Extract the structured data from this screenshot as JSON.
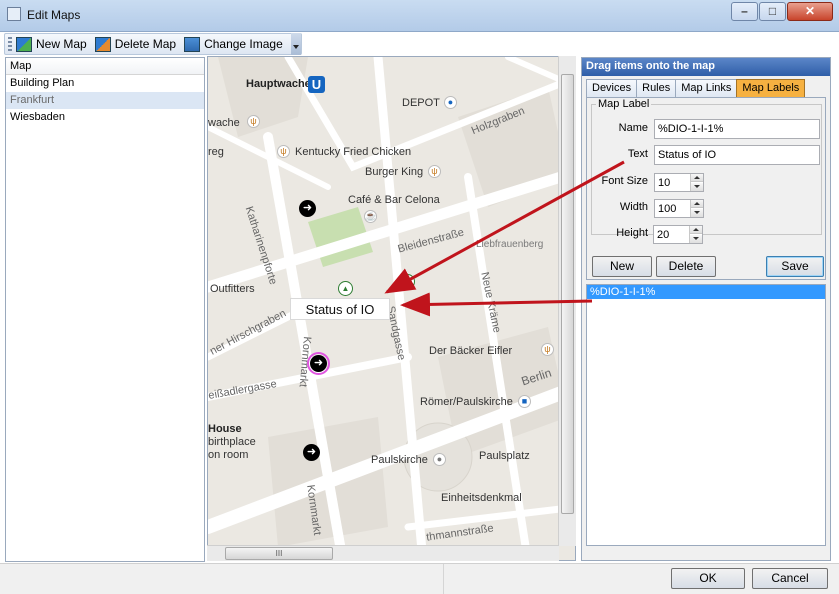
{
  "window": {
    "title": "Edit Maps",
    "min_glyph": "–",
    "max_glyph": "□",
    "close_glyph": "✕"
  },
  "toolbar": {
    "new_map": "New Map",
    "delete_map": "Delete Map",
    "change_image": "Change Image"
  },
  "map_list": {
    "header": "Map",
    "items": [
      "Building Plan",
      "Frankfurt",
      "Wiesbaden"
    ],
    "selected": "Frankfurt"
  },
  "map": {
    "labels": {
      "hauptwache": "Hauptwache",
      "depot": "DEPOT",
      "wache": "wache",
      "holzgraben": "Holzgraben",
      "reg": "reg",
      "kfc": "Kentucky Fried Chicken",
      "burger_king": "Burger King",
      "katharinenpforte": "Katharinenpforte",
      "cafe": "Café & Bar Celona",
      "bleidenstrasse": "Bleidenstraße",
      "liebfrauenberg": "Liebfrauenberg",
      "outfitters": "Outfitters",
      "hirschgraben": "ner Hirschgraben",
      "neue_kraeme": "Neue Kräme",
      "sandgasse": "Sandgasse",
      "baecker": "Der Bäcker Eifler",
      "kornmarkt": "Kornmarkt",
      "eissadlergasse": "eißadlergasse",
      "berlin": "Berlin",
      "roemer": "Römer/Paulskirche",
      "house": "House",
      "birthplace": "birthplace",
      "on_room": "on room",
      "paulskirche": "Paulskirche",
      "paulsplatz": "Paulsplatz",
      "einheitsdenkmal": "Einheitsdenkmal",
      "kornmarkt2": "Kornmarkt",
      "mannstrasse": "thmannstraße"
    },
    "ubahn_glyph": "U",
    "status_label": "Status of IO",
    "hscroll_grip": "III"
  },
  "right_panel": {
    "header": "Drag items onto the map",
    "tabs": [
      "Devices",
      "Rules",
      "Map Links",
      "Map Labels"
    ],
    "active_tab": "Map Labels",
    "group_title": "Map Label",
    "fields": {
      "name_label": "Name",
      "name_value": "%DIO-1-I-1%",
      "text_label": "Text",
      "text_value": "Status of IO",
      "font_size_label": "Font Size",
      "font_size_value": "10",
      "width_label": "Width",
      "width_value": "100",
      "height_label": "Height",
      "height_value": "20"
    },
    "buttons": {
      "new": "New",
      "delete": "Delete",
      "save": "Save"
    },
    "label_list": [
      "%DIO-1-I-1%"
    ]
  },
  "footer": {
    "ok": "OK",
    "cancel": "Cancel"
  },
  "colors": {
    "accent_tab": "#f6b141",
    "selection": "#3399ff",
    "annotation_arrow": "#c0141c",
    "header_blue": "#2f5ea8"
  }
}
